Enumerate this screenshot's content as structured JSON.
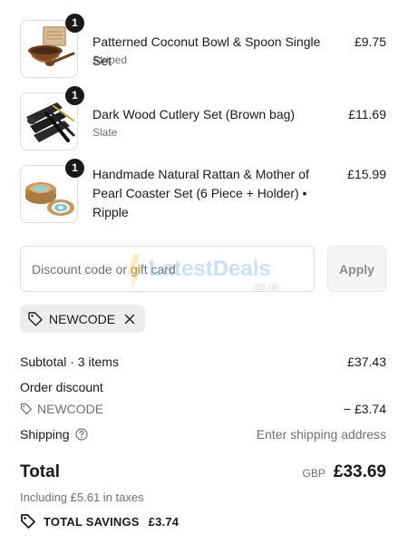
{
  "line_items": [
    {
      "quantity": "1",
      "title": "Patterned Coconut Bowl & Spoon Single Set",
      "variant": "Striped",
      "price": "£9.75",
      "thumb_icon": "coconut-bowl-icon"
    },
    {
      "quantity": "1",
      "title": "Dark Wood Cutlery Set (Brown bag)",
      "variant": "Slate",
      "price": "£11.69",
      "thumb_icon": "cutlery-set-icon"
    },
    {
      "quantity": "1",
      "title": "Handmade Natural Rattan & Mother of Pearl Coaster Set (6 Piece + Holder) • Ripple",
      "variant": "",
      "price": "£15.99",
      "thumb_icon": "coaster-set-icon"
    }
  ],
  "discount": {
    "placeholder": "Discount code or gift card",
    "apply_label": "Apply",
    "applied_code": "NEWCODE"
  },
  "watermark": {
    "brand": "LatestDeals",
    "domain": ".co.uk"
  },
  "summary": {
    "subtotal_label": "Subtotal · 3 items",
    "subtotal_value": "£37.43",
    "order_discount_label": "Order discount",
    "discount_code": "NEWCODE",
    "discount_value": "− £3.74",
    "shipping_label": "Shipping",
    "shipping_value": "Enter shipping address",
    "total_label": "Total",
    "currency": "GBP",
    "total_value": "£33.69",
    "tax_note": "Including £5.61 in taxes",
    "savings_label": "TOTAL SAVINGS",
    "savings_value": "£3.74"
  },
  "colors": {
    "text": "#1a1a1a",
    "muted": "#707070",
    "badge": "#1a1a1a",
    "chip_bg": "#ededed",
    "border": "#dedede"
  }
}
